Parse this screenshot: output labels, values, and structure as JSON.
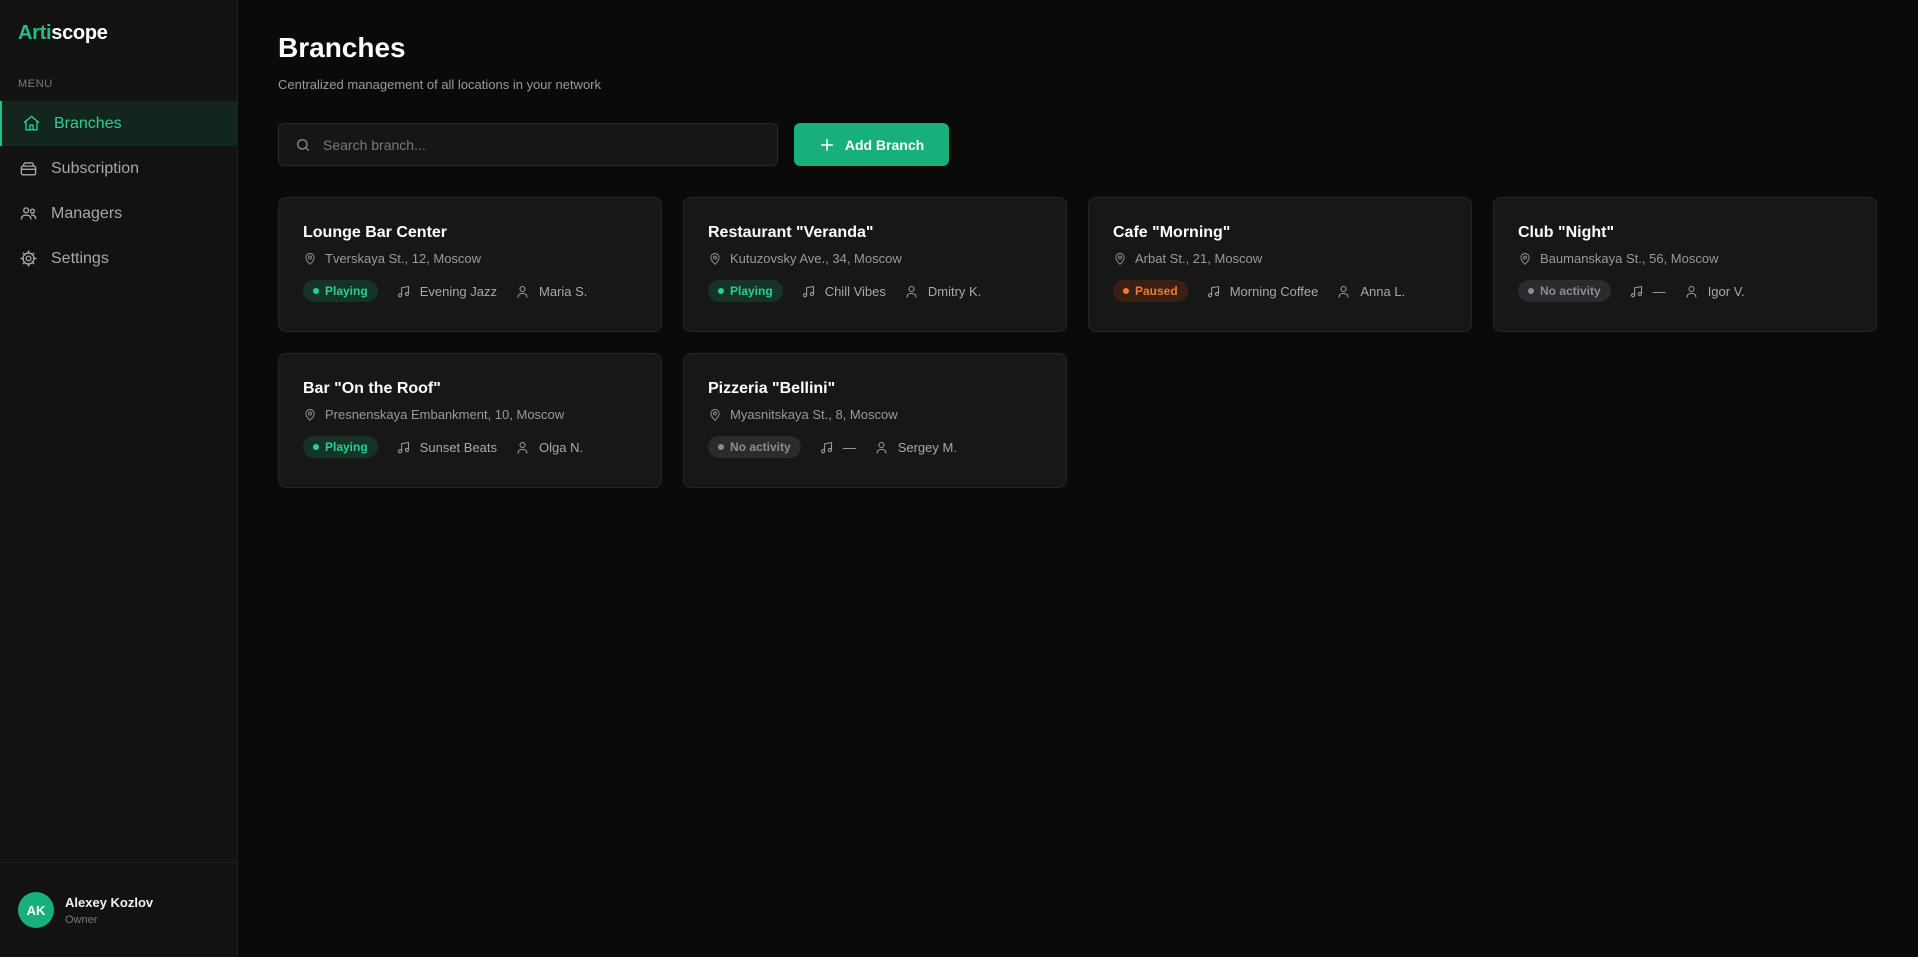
{
  "app": {
    "logo_part1": "Arti",
    "logo_part2": "scope",
    "accent_color": "#17b07a"
  },
  "sidebar": {
    "menu_label": "MENU",
    "items": [
      {
        "label": "Branches",
        "icon": "home-icon",
        "active": true
      },
      {
        "label": "Subscription",
        "icon": "subscription-icon",
        "active": false
      },
      {
        "label": "Managers",
        "icon": "users-icon",
        "active": false
      },
      {
        "label": "Settings",
        "icon": "gear-icon",
        "active": false
      }
    ],
    "user": {
      "initials": "AK",
      "name": "Alexey Kozlov",
      "role": "Owner"
    }
  },
  "main": {
    "title": "Branches",
    "subtitle": "Centralized management of all locations in your network",
    "search": {
      "placeholder": "Search branch...",
      "value": ""
    },
    "add_button_label": "Add Branch"
  },
  "branches": [
    {
      "name": "Lounge Bar Center",
      "address": "Tverskaya St., 12, Moscow",
      "status": "Playing",
      "status_type": "playing",
      "playlist": "Evening Jazz",
      "manager": "Maria S."
    },
    {
      "name": "Restaurant \"Veranda\"",
      "address": "Kutuzovsky Ave., 34, Moscow",
      "status": "Playing",
      "status_type": "playing",
      "playlist": "Chill Vibes",
      "manager": "Dmitry K."
    },
    {
      "name": "Cafe \"Morning\"",
      "address": "Arbat St., 21, Moscow",
      "status": "Paused",
      "status_type": "paused",
      "playlist": "Morning Coffee",
      "manager": "Anna L."
    },
    {
      "name": "Club \"Night\"",
      "address": "Baumanskaya St., 56, Moscow",
      "status": "No activity",
      "status_type": "none",
      "playlist": "—",
      "manager": "Igor V."
    },
    {
      "name": "Bar \"On the Roof\"",
      "address": "Presnenskaya Embankment, 10, Moscow",
      "status": "Playing",
      "status_type": "playing",
      "playlist": "Sunset Beats",
      "manager": "Olga N."
    },
    {
      "name": "Pizzeria \"Bellini\"",
      "address": "Myasnitskaya St., 8, Moscow",
      "status": "No activity",
      "status_type": "none",
      "playlist": "—",
      "manager": "Sergey M."
    }
  ]
}
